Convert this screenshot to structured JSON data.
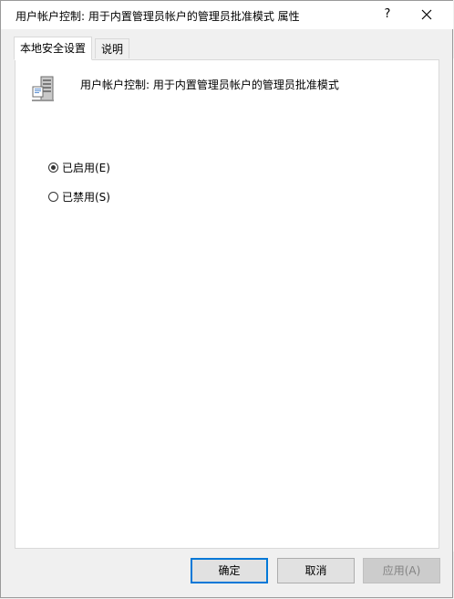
{
  "window": {
    "title": "用户帐户控制: 用于内置管理员帐户的管理员批准模式 属性",
    "help_label": "?",
    "close_label": "✕"
  },
  "tabs": [
    {
      "label": "本地安全设置",
      "active": true
    },
    {
      "label": "说明",
      "active": false
    }
  ],
  "policy": {
    "icon": "server-computer-icon",
    "title": "用户帐户控制: 用于内置管理员帐户的管理员批准模式"
  },
  "options": [
    {
      "label": "已启用(E)",
      "checked": true
    },
    {
      "label": "已禁用(S)",
      "checked": false
    }
  ],
  "buttons": {
    "ok": "确定",
    "cancel": "取消",
    "apply": "应用(A)"
  },
  "colors": {
    "accent": "#0078d7",
    "dialog_bg": "#f0f0f0",
    "panel_bg": "#ffffff"
  }
}
